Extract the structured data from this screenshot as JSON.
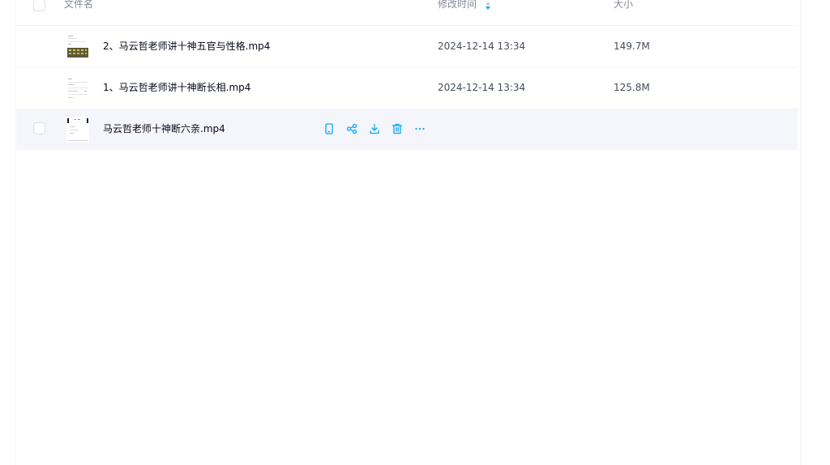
{
  "header": {
    "col_name": "文件名",
    "col_modified": "修改时间",
    "col_size": "大小"
  },
  "files": [
    {
      "name": "2、马云哲老师讲十神五官与性格.mp4",
      "modified": "2024-12-14 13:34",
      "size": "149.7M"
    },
    {
      "name": "1、马云哲老师讲十神断长相.mp4",
      "modified": "2024-12-14 13:34",
      "size": "125.8M"
    },
    {
      "name": "马云哲老师十神断六亲.mp4",
      "modified": "",
      "size": ""
    }
  ],
  "row_actions": [
    "phone-icon",
    "share-icon",
    "download-icon",
    "delete-icon",
    "more-icon"
  ],
  "colors": {
    "accent": "#06a7ff",
    "hover_row": "#f4f6fb",
    "header_text": "#818999",
    "body_text": "#03081a",
    "meta_text": "#454d5a"
  }
}
